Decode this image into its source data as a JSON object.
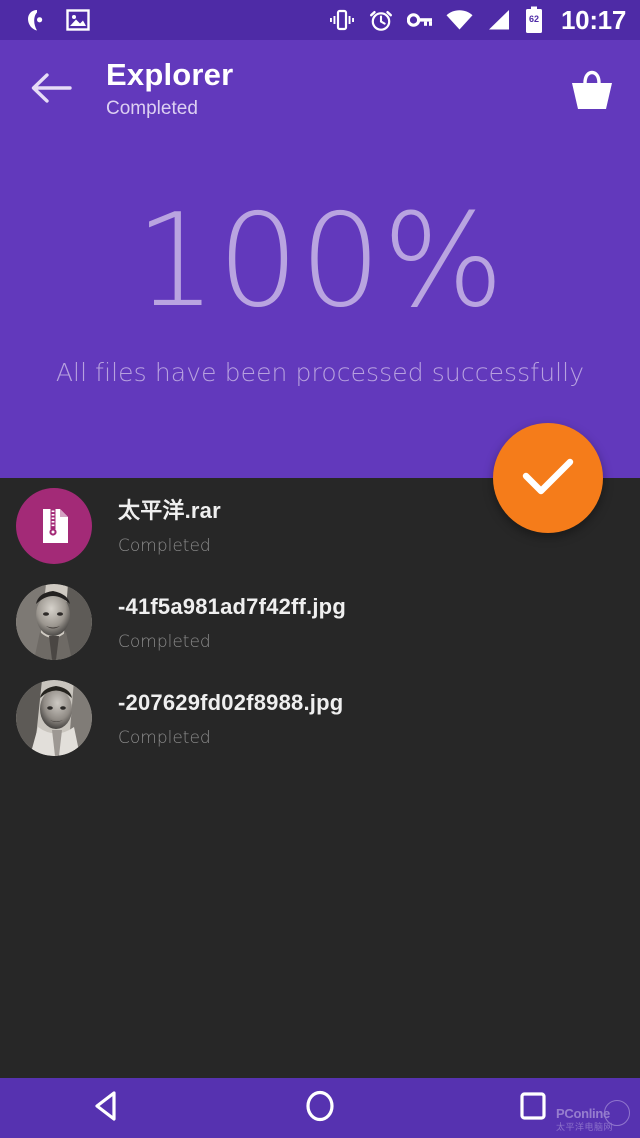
{
  "status_bar": {
    "icons": [
      "app-notification-icon",
      "image-notification-icon",
      "vibrate-icon",
      "alarm-icon",
      "vpn-key-icon",
      "wifi-icon",
      "signal-icon",
      "battery-icon"
    ],
    "battery_level": "62",
    "time": "10:17"
  },
  "appbar": {
    "back_label": "back-arrow",
    "title": "Explorer",
    "subtitle": "Completed",
    "action_label": "basket"
  },
  "hero": {
    "percent": "100%",
    "message": "All files have been processed successfully"
  },
  "fab": {
    "label": "done-check"
  },
  "files": [
    {
      "name": "太平洋.rar",
      "status": "Completed",
      "icon": "zip-file-icon",
      "thumb_type": "zip"
    },
    {
      "name": "-41f5a981ad7f42ff.jpg",
      "status": "Completed",
      "icon": "photo-thumbnail",
      "thumb_type": "photo-a"
    },
    {
      "name": "-207629fd02f8988.jpg",
      "status": "Completed",
      "icon": "photo-thumbnail",
      "thumb_type": "photo-b"
    }
  ],
  "navbar": {
    "back": "back-triangle",
    "home": "home-circle",
    "recents": "recents-square"
  },
  "watermark": {
    "main": "PConline",
    "sub": "太平洋电脑网"
  },
  "colors": {
    "status_bar": "#4e2ba6",
    "app_bar": "#6239bc",
    "accent": "#f57c1a",
    "list_bg": "#272727",
    "zip_circle": "#a32a77",
    "nav_bar": "#5632b0"
  }
}
